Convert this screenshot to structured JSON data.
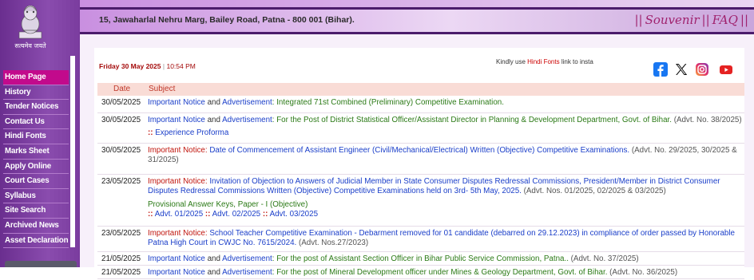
{
  "emblem_caption": "सत्यमेव जयते",
  "menu": [
    "Home Page",
    "History",
    "Tender Notices",
    "Contact Us",
    "Hindi Fonts",
    "Marks Sheet",
    "Apply Online",
    "Court Cases",
    "Syllabus",
    "Site Search",
    "Archived News",
    "Asset Declaration"
  ],
  "header": {
    "address": "15, Jawaharlal Nehru Marg, Bailey Road, Patna - 800 001 (Bihar).",
    "sep": "||",
    "souvenir": "Souvenir",
    "faq": "FAQ"
  },
  "datetime": {
    "date": "Friday 30 May 2025",
    "sep": "|",
    "time": "10:54 PM"
  },
  "hindi_note": {
    "before": "Kindly use ",
    "link": "Hindi Fonts",
    "after": " link to insta"
  },
  "social": [
    "facebook-icon",
    "x-icon",
    "instagram-icon",
    "youtube-icon"
  ],
  "colors": {
    "sidebar": "#7a3c9e",
    "active_menu": "#c20a8c",
    "link": "#1a3ec9",
    "red": "#c0140c",
    "green": "#2b7a16",
    "header_accent": "#a0226e"
  },
  "table": {
    "col_date": "Date",
    "col_subject": "Subject",
    "rows": [
      {
        "date": "30/05/2025",
        "notice": "Important Notice",
        "and": " and ",
        "adv": "Advertisement",
        "colon": ": ",
        "text": "Integrated 71st Combined (Preliminary) Competitive Examination."
      },
      {
        "date": "30/05/2025",
        "notice": "Important Notice",
        "and": " and ",
        "adv": "Advertisement",
        "colon": ": ",
        "text": "For the Post of District Statistical Officer/Assistant Director in Planning & Development Department, Govt. of Bihar.",
        "advt": " (Advt. No. 38/2025)",
        "sub_marker": "::",
        "sub_text": "Experience Proforma"
      },
      {
        "date": "30/05/2025",
        "notice": "Important Notice:",
        "text": " Date of Commencement of Assistant Engineer (Civil/Mechanical/Electrical) Written (Objective) Competitive Examinations.",
        "advt": " (Advt. No. 29/2025, 30/2025 & 31/2025)"
      },
      {
        "date": "23/05/2025",
        "notice": "Important Notice:",
        "text": " Invitation of Objection to Answers of Judicial Member in State Consumer Disputes Redressal Commissions, President/Member in District Consumer Disputes Redressal Commissions Written (Objective) Competitive Examinations held on 3rd- 5th May, 2025.",
        "advt": " (Advt. Nos. 01/2025, 02/2025 & 03/2025)",
        "sub_title": "Provisional Answer Keys, Paper - I (Objective)",
        "sub_marker": "::",
        "sub_links": [
          "Advt. 01/2025",
          "Advt. 02/2025",
          "Advt. 03/2025"
        ]
      },
      {
        "date": "23/05/2025",
        "notice": "Important Notice:",
        "text": " School Teacher Competitive Examination - Debarment removed for 01 candidate (debarred on 29.12.2023) in compliance of order passed by Honorable Patna High Court in CWJC No. 7615/2024.",
        "advt": " (Advt. Nos.27/2023)"
      },
      {
        "date": "21/05/2025",
        "notice": "Important Notice",
        "and": " and ",
        "adv": "Advertisement",
        "colon": ": ",
        "text": "For the post of Assistant Section Officer in Bihar Public Service Commission, Patna..",
        "advt": " (Advt. No. 37/2025)"
      },
      {
        "date": "21/05/2025",
        "notice": "Important Notice",
        "and": " and ",
        "adv": "Advertisement",
        "colon": ": ",
        "text": "For the post of Mineral Development officer under Mines & Geology Department, Govt. of Bihar.",
        "advt": " (Advt. No. 36/2025)"
      }
    ]
  }
}
